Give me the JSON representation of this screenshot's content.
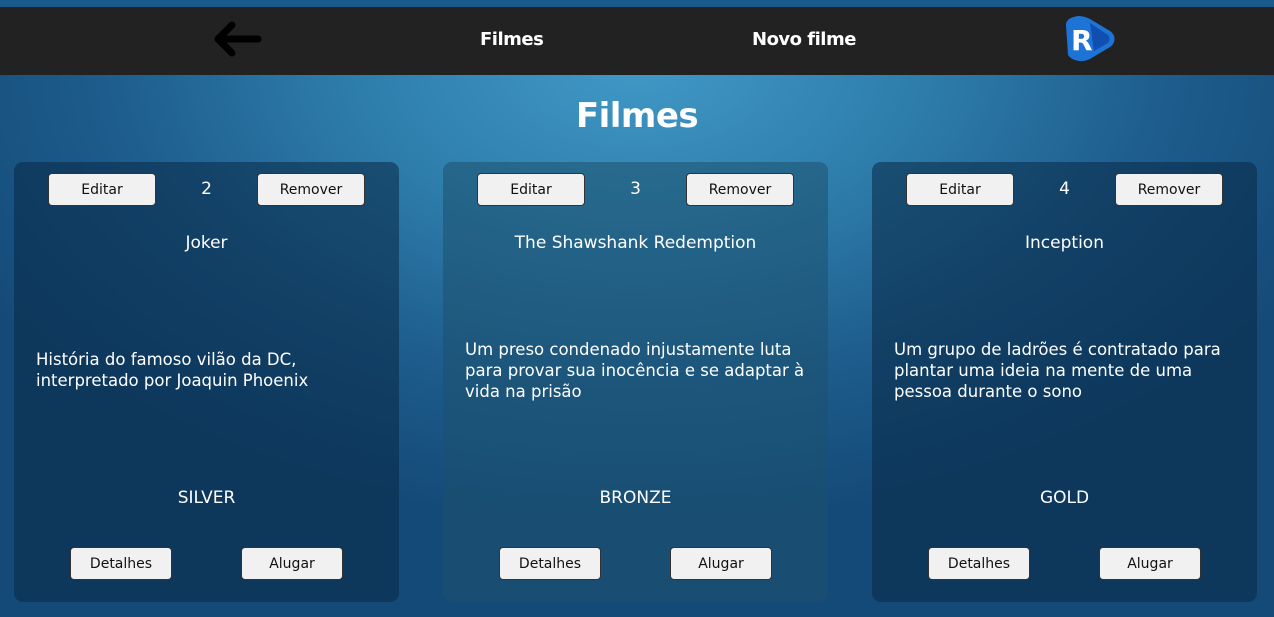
{
  "nav": {
    "back_icon": "arrow-left-icon",
    "links": [
      {
        "label": "Filmes"
      },
      {
        "label": "Novo filme"
      }
    ],
    "logo_letter": "R",
    "logo_color": "#1e73d6"
  },
  "page": {
    "title": "Filmes"
  },
  "colors": {
    "navbar_bg": "#222222",
    "background": "#2f7fad",
    "button_bg": "#f1f1f1"
  },
  "movies": [
    {
      "edit_label": "Editar",
      "id": "2",
      "remove_label": "Remover",
      "title": "Joker",
      "description": "História do famoso vilão da DC, interpretado por Joaquin Phoenix",
      "tier": "SILVER",
      "details_label": "Detalhes",
      "rent_label": "Alugar"
    },
    {
      "edit_label": "Editar",
      "id": "3",
      "remove_label": "Remover",
      "title": "The Shawshank Redemption",
      "description": "Um preso condenado injustamente luta para provar sua inocência e se adaptar à vida na prisão",
      "tier": "BRONZE",
      "details_label": "Detalhes",
      "rent_label": "Alugar"
    },
    {
      "edit_label": "Editar",
      "id": "4",
      "remove_label": "Remover",
      "title": "Inception",
      "description": "Um grupo de ladrões é contratado para plantar uma ideia na mente de uma pessoa durante o sono",
      "tier": "GOLD",
      "details_label": "Detalhes",
      "rent_label": "Alugar"
    }
  ]
}
